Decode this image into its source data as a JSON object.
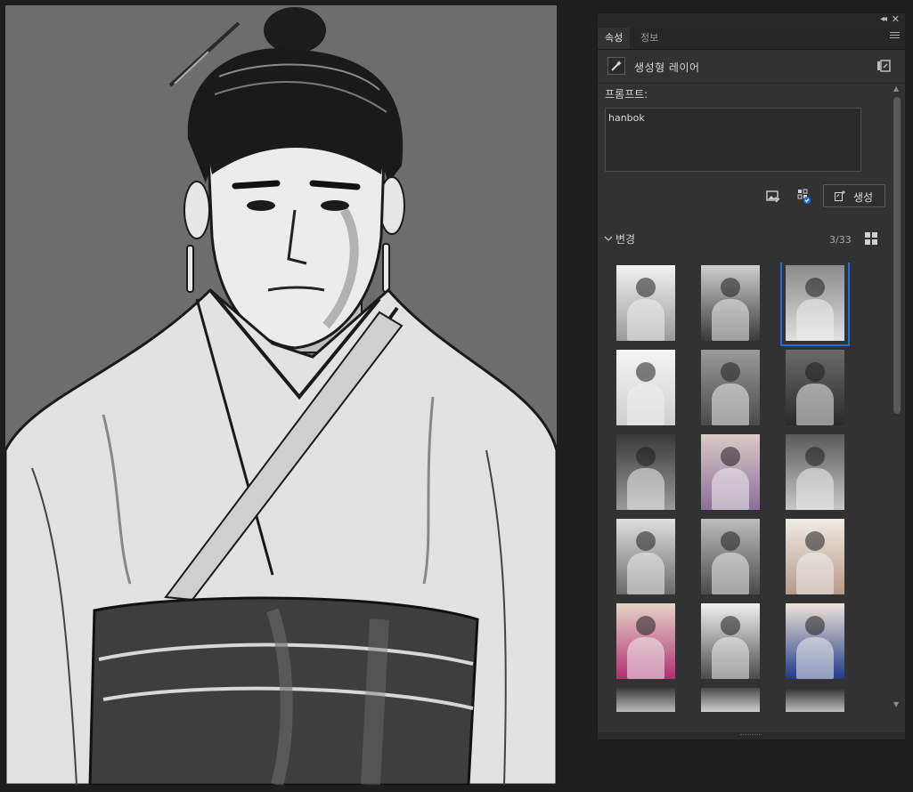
{
  "tabs": [
    {
      "label": "속성",
      "active": true
    },
    {
      "label": "정보",
      "active": false
    }
  ],
  "panel": {
    "collapse_icon": "double-chevron-left-icon",
    "close_icon": "close-icon",
    "menu_icon": "hamburger-menu-icon"
  },
  "layer": {
    "icon": "generative-layer-icon",
    "title": "생성형 레이어",
    "action_icon": "layer-action-icon"
  },
  "prompt": {
    "label": "프롬프트:",
    "value": "hanbok"
  },
  "toolbar": {
    "reference_image_icon": "reference-image-icon",
    "style_icon": "content-style-icon",
    "generate_label": "생성"
  },
  "variations": {
    "title": "변경",
    "count": "3/33",
    "selected_index": 2,
    "grid_icon": "grid-view-icon",
    "items": [
      {
        "label": "bw-woman-dancing"
      },
      {
        "label": "bw-couple-walking"
      },
      {
        "label": "bw-man-hanbok-sketch"
      },
      {
        "label": "bw-woman-portrait"
      },
      {
        "label": "bw-women-street"
      },
      {
        "label": "bw-man-hanbok"
      },
      {
        "label": "bw-man-smiling"
      },
      {
        "label": "color-man-hanbok"
      },
      {
        "label": "bw-woman-seated"
      },
      {
        "label": "bw-dancer-skirt"
      },
      {
        "label": "bw-dancer-spinning"
      },
      {
        "label": "color-dancer"
      },
      {
        "label": "color-woman-pink-hanbok"
      },
      {
        "label": "bw-woman-smiling"
      },
      {
        "label": "color-woman-blue-hanbok"
      },
      {
        "label": "sky-partial-1"
      },
      {
        "label": "sky-partial-2"
      },
      {
        "label": "sky-partial-3"
      }
    ]
  },
  "colors": {
    "accent": "#1f6fe0",
    "panel_bg": "#323232",
    "app_bg": "#1e1e1e"
  }
}
